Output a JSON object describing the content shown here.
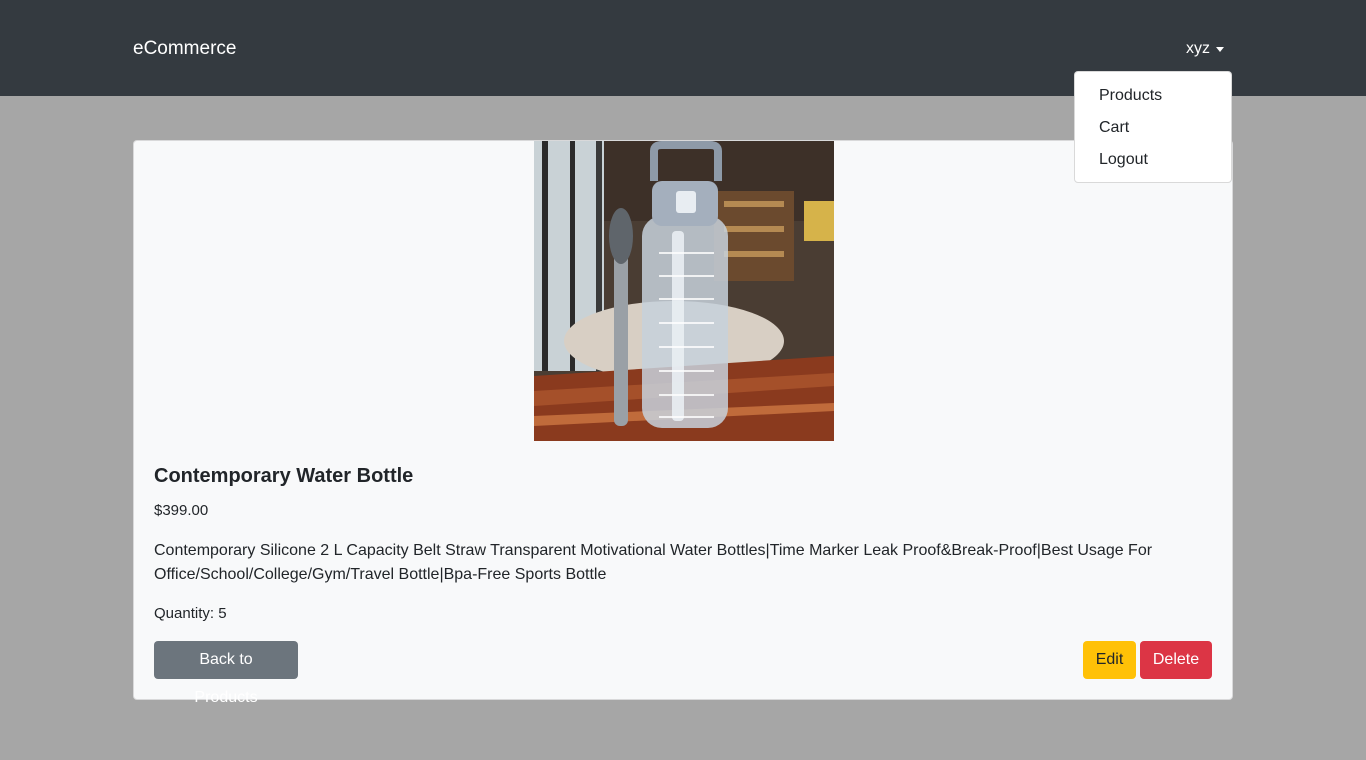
{
  "navbar": {
    "brand": "eCommerce",
    "user": "xyz"
  },
  "dropdown": {
    "items": [
      "Products",
      "Cart",
      "Logout"
    ]
  },
  "product": {
    "image_alt": "Contemporary Water Bottle",
    "title": "Contemporary Water Bottle",
    "price": "$399.00",
    "description": "Contemporary Silicone 2 L Capacity Belt Straw Transparent Motivational Water Bottles|Time Marker Leak Proof&Break-Proof|Best Usage For Office/School/College/Gym/Travel Bottle|Bpa-Free Sports Bottle",
    "quantity": "Quantity: 5"
  },
  "buttons": {
    "back": "Back to Products",
    "edit": "Edit",
    "delete": "Delete"
  },
  "colors": {
    "navbar": "#343a40",
    "backdrop": "#a6a6a6",
    "card": "#f8f9fa",
    "secondary": "#6c757d",
    "warning": "#ffc107",
    "danger": "#dc3545"
  }
}
